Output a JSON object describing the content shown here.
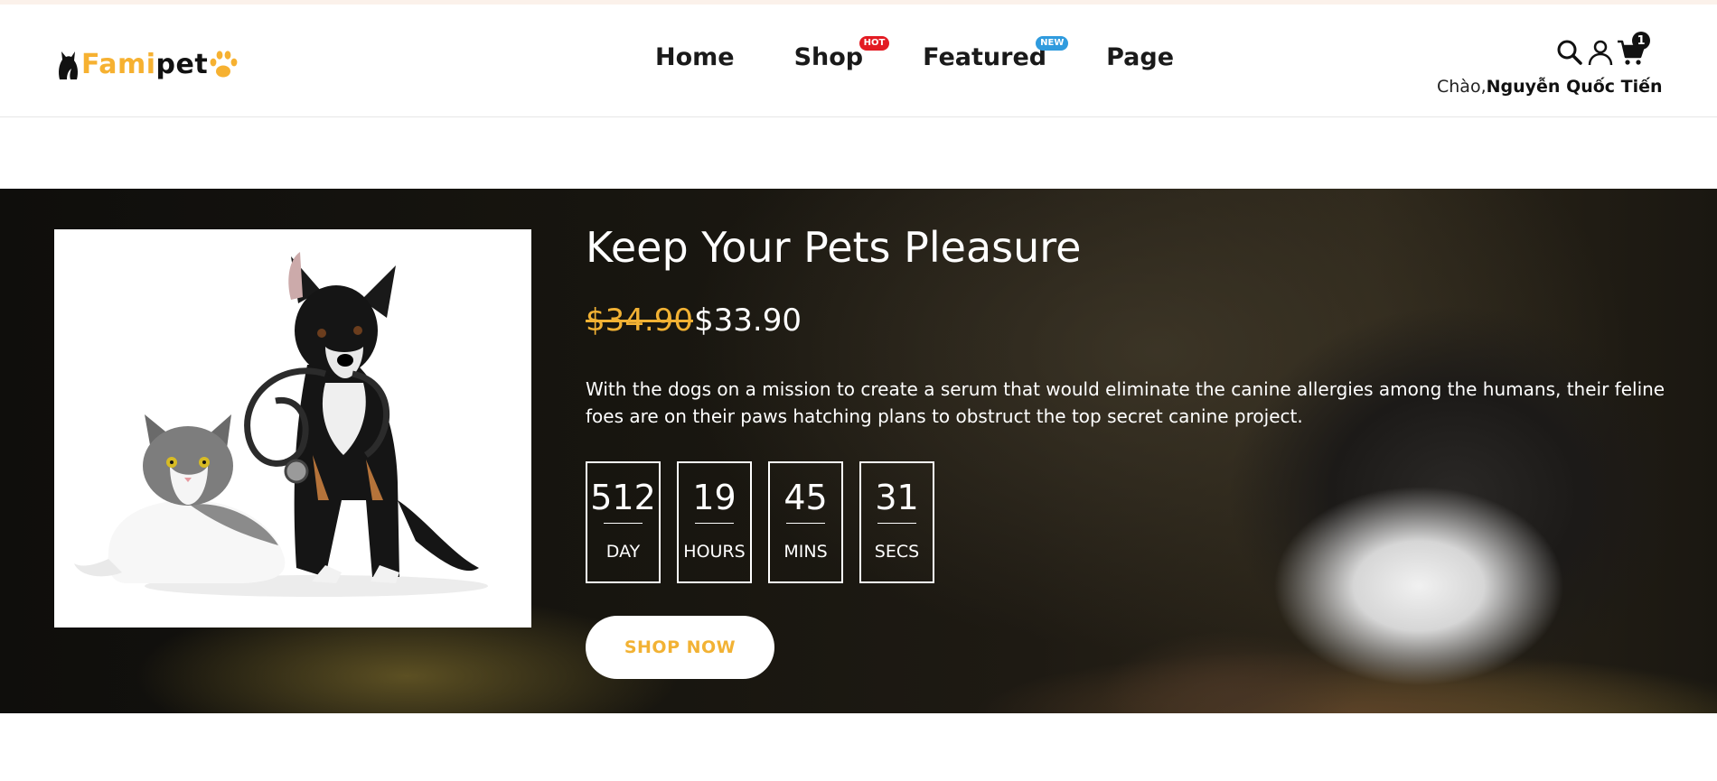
{
  "brand": {
    "name_part1": "Fami",
    "name_part2": "pet",
    "accent_color": "#f6b131",
    "logo_icons": [
      "cat-silhouette-icon",
      "paw-icon"
    ]
  },
  "nav": {
    "items": [
      {
        "label": "Home",
        "badge": null
      },
      {
        "label": "Shop",
        "badge": "HOT",
        "badge_color": "#e31b23"
      },
      {
        "label": "Featured",
        "badge": "NEW",
        "badge_color": "#2f9bde"
      },
      {
        "label": "Page",
        "badge": null
      }
    ]
  },
  "header_icons": {
    "search": "search-icon",
    "user": "user-icon",
    "cart": "cart-icon",
    "cart_count": "1"
  },
  "greeting": {
    "prefix": "Chào,",
    "name": "Nguyễn Quốc Tiến"
  },
  "hero": {
    "title": "Keep Your Pets Pleasure",
    "old_price": "$34.90",
    "new_price": "$33.90",
    "description": "With the dogs on a mission to create a serum that would eliminate the canine allergies among the humans, their feline foes are on their paws hatching plans to obstruct the top secret canine project.",
    "countdown": [
      {
        "value": "512",
        "label": "DAY"
      },
      {
        "value": "19",
        "label": "HOURS"
      },
      {
        "value": "45",
        "label": "MINS"
      },
      {
        "value": "31",
        "label": "SECS"
      }
    ],
    "cta": "SHOP NOW",
    "product_image": "cat-and-dog-with-stethoscope",
    "background_image": "dog-resting-on-tree-stump"
  }
}
